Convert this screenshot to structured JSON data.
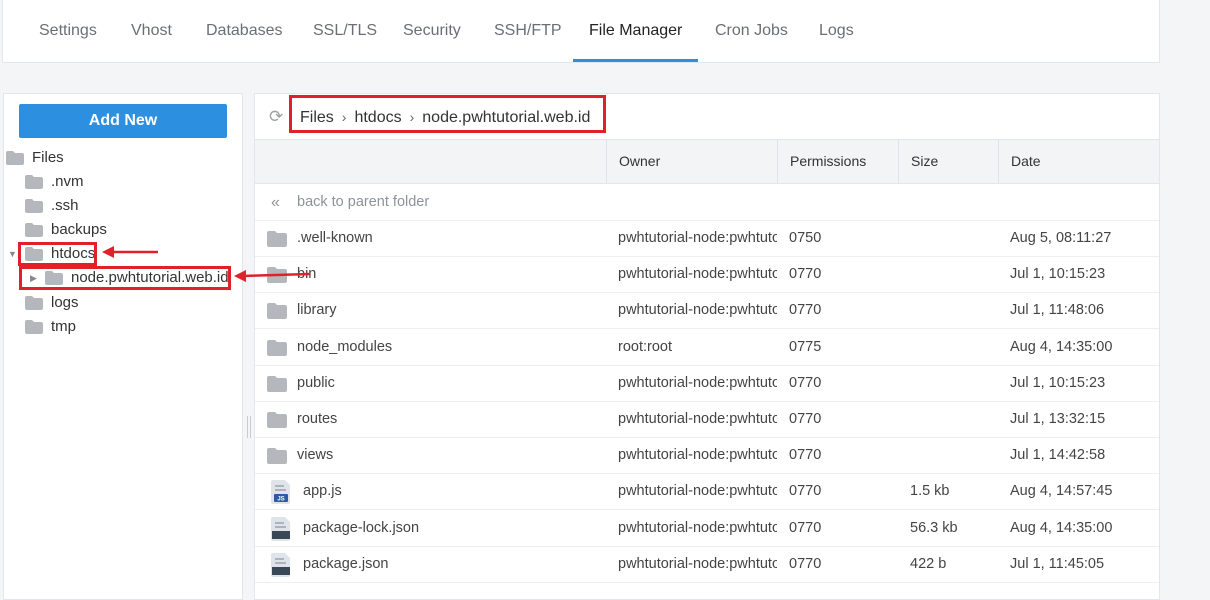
{
  "tabs": [
    "Settings",
    "Vhost",
    "Databases",
    "SSL/TLS",
    "Security",
    "SSH/FTP",
    "File Manager",
    "Cron Jobs",
    "Logs"
  ],
  "active_tab": "File Manager",
  "tree": {
    "add_new_label": "Add New",
    "root": "Files",
    "items": [
      ".nvm",
      ".ssh",
      "backups",
      "htdocs",
      "node.pwhtutorial.web.id",
      "logs",
      "tmp"
    ]
  },
  "breadcrumb": [
    "Files",
    "htdocs",
    "node.pwhtutorial.web.id"
  ],
  "table": {
    "columns": [
      "Owner",
      "Permissions",
      "Size",
      "Date"
    ],
    "back_label": "back to parent folder",
    "rows": [
      {
        "name": ".well-known",
        "type": "folder",
        "owner": "pwhtutorial-node:pwhtutorial-node",
        "perm": "0750",
        "size": "",
        "date": "Aug 5, 08:11:27"
      },
      {
        "name": "bin",
        "type": "folder",
        "owner": "pwhtutorial-node:pwhtutorial-node",
        "perm": "0770",
        "size": "",
        "date": "Jul 1, 10:15:23"
      },
      {
        "name": "library",
        "type": "folder",
        "owner": "pwhtutorial-node:pwhtutorial-node",
        "perm": "0770",
        "size": "",
        "date": "Jul 1, 11:48:06"
      },
      {
        "name": "node_modules",
        "type": "folder",
        "owner": "root:root",
        "perm": "0775",
        "size": "",
        "date": "Aug 4, 14:35:00"
      },
      {
        "name": "public",
        "type": "folder",
        "owner": "pwhtutorial-node:pwhtutorial-node",
        "perm": "0770",
        "size": "",
        "date": "Jul 1, 10:15:23"
      },
      {
        "name": "routes",
        "type": "folder",
        "owner": "pwhtutorial-node:pwhtutorial-node",
        "perm": "0770",
        "size": "",
        "date": "Jul 1, 13:32:15"
      },
      {
        "name": "views",
        "type": "folder",
        "owner": "pwhtutorial-node:pwhtutorial-node",
        "perm": "0770",
        "size": "",
        "date": "Jul 1, 14:42:58"
      },
      {
        "name": "app.js",
        "type": "js",
        "owner": "pwhtutorial-node:pwhtutorial-node",
        "perm": "0770",
        "size": "1.5 kb",
        "date": "Aug 4, 14:57:45"
      },
      {
        "name": "package-lock.json",
        "type": "file",
        "owner": "pwhtutorial-node:pwhtutorial-node",
        "perm": "0770",
        "size": "56.3 kb",
        "date": "Aug 4, 14:35:00"
      },
      {
        "name": "package.json",
        "type": "file",
        "owner": "pwhtutorial-node:pwhtutorial-node",
        "perm": "0770",
        "size": "422 b",
        "date": "Jul 1, 11:45:05"
      }
    ]
  },
  "colors": {
    "accent": "#2d8fe0",
    "highlight": "#e0202a",
    "folder": "#b4b8bd"
  }
}
